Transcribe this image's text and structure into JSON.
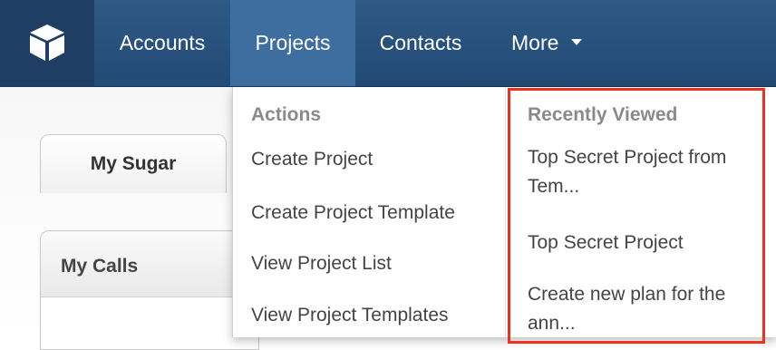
{
  "nav": {
    "logo_icon": "sugar-cube-icon",
    "items": [
      {
        "label": "Accounts"
      },
      {
        "label": "Projects"
      },
      {
        "label": "Contacts"
      },
      {
        "label": "More"
      }
    ],
    "active_color": "#3e6ea0",
    "bar_color": "#2a5480"
  },
  "background": {
    "tab_label": "My Sugar",
    "dashlet_title": "My Calls"
  },
  "dropdown": {
    "actions_header": "Actions",
    "actions": [
      {
        "label": "Create Project"
      },
      {
        "label": "Create Project Template"
      },
      {
        "label": "View Project List"
      },
      {
        "label": "View Project Templates"
      }
    ],
    "recent_header": "Recently Viewed",
    "recent": [
      {
        "label": "Top Secret Project from Tem..."
      },
      {
        "label": "Top Secret Project"
      },
      {
        "label": "Create new plan for the ann..."
      }
    ],
    "highlight_color": "#e8321f"
  }
}
